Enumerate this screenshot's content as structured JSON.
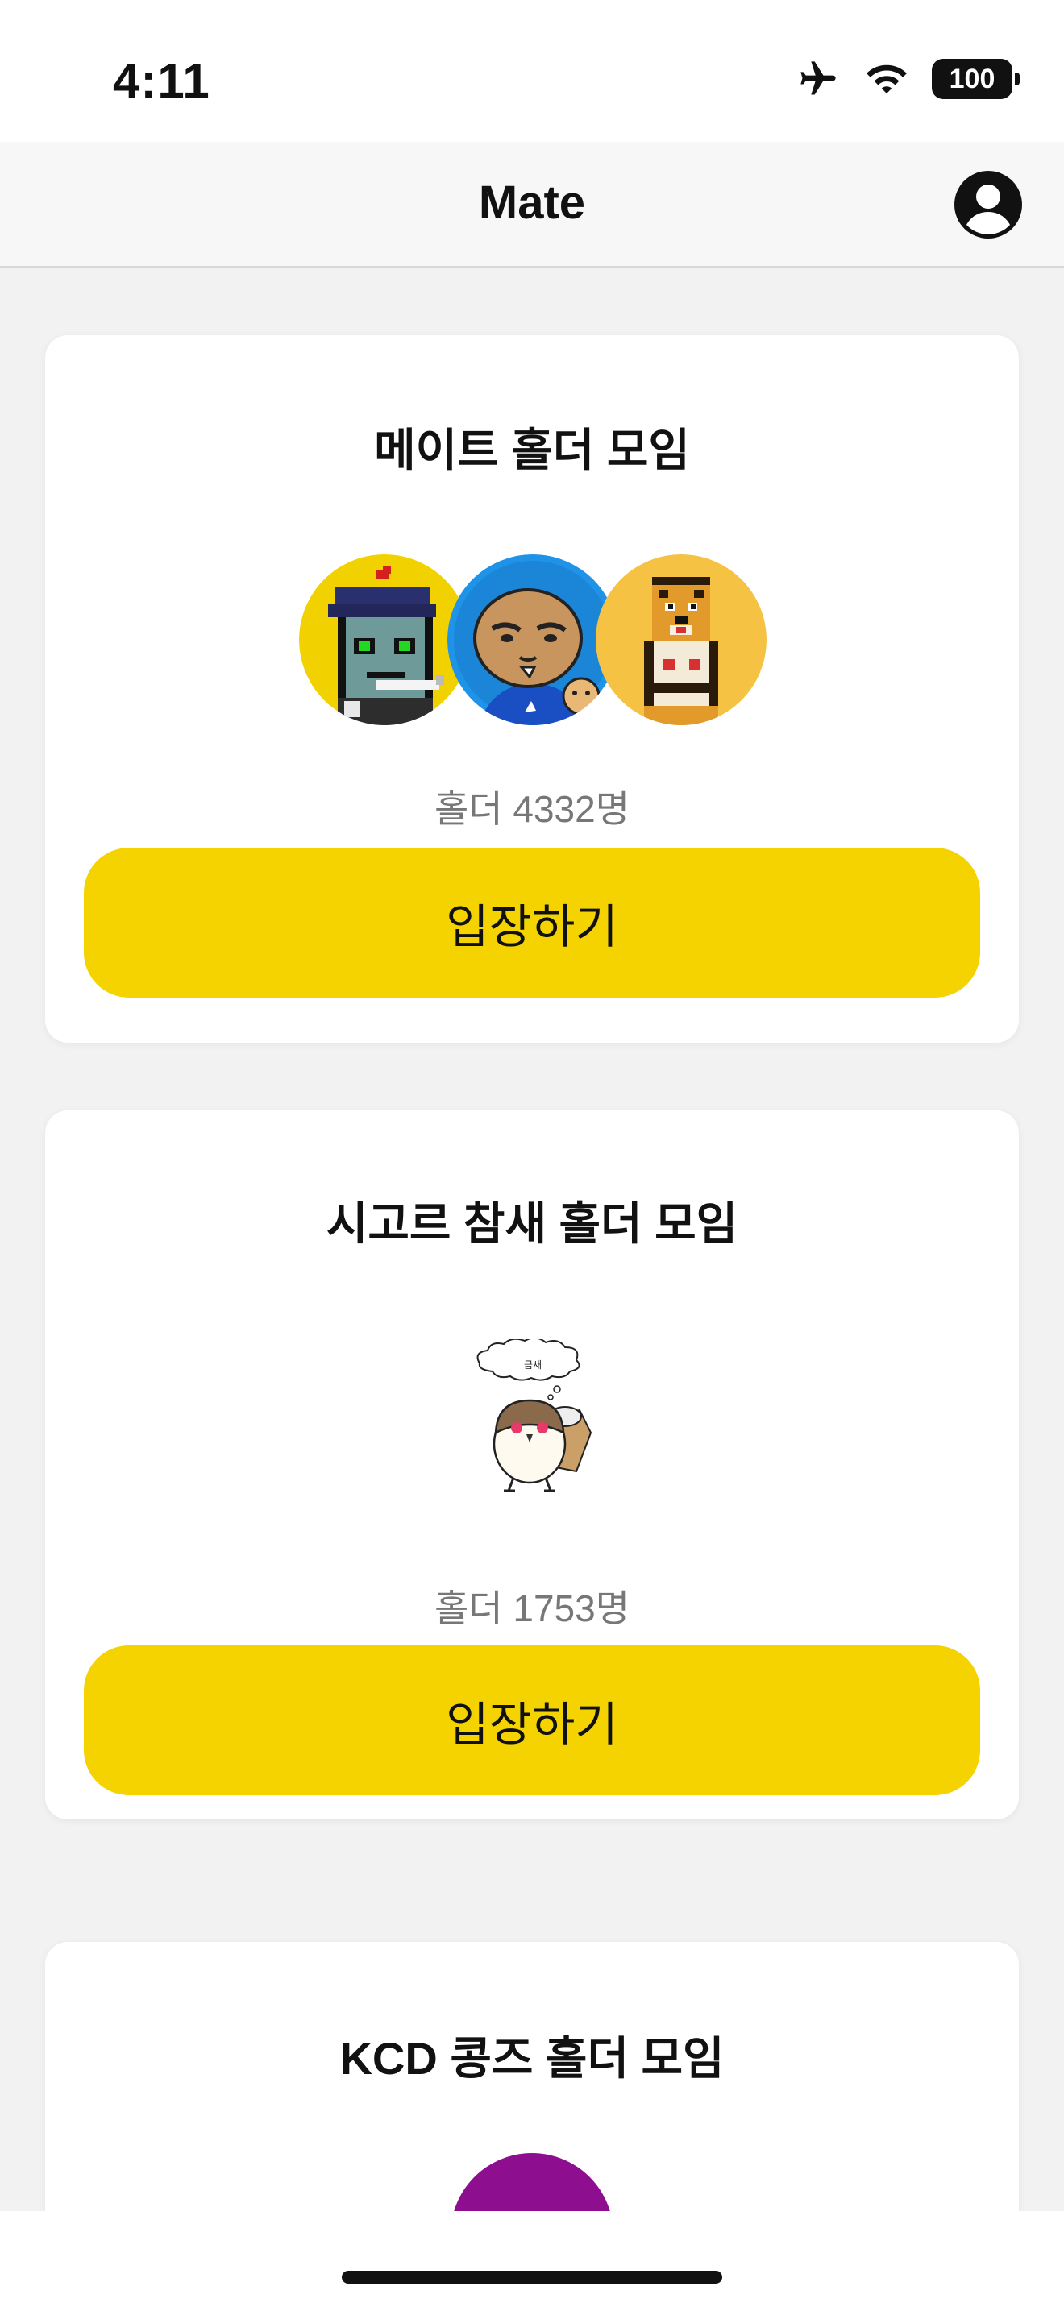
{
  "status_bar": {
    "time": "4:11",
    "battery": "100"
  },
  "nav": {
    "title": "Mate"
  },
  "cards": [
    {
      "title": "메이트 홀더 모임",
      "holders": "홀더 4332명",
      "button": "입장하기"
    },
    {
      "title": "시고르 참새 홀더 모임",
      "holders": "홀더 1753명",
      "button": "입장하기",
      "image_caption": "금새"
    },
    {
      "title": "KCD 콩즈 홀더 모임"
    }
  ],
  "colors": {
    "accent": "#f5d300",
    "background": "#f2f2f2",
    "card": "#ffffff",
    "muted_text": "#777777"
  },
  "icons": [
    "airplane-icon",
    "wifi-icon",
    "battery-icon",
    "profile-icon"
  ]
}
